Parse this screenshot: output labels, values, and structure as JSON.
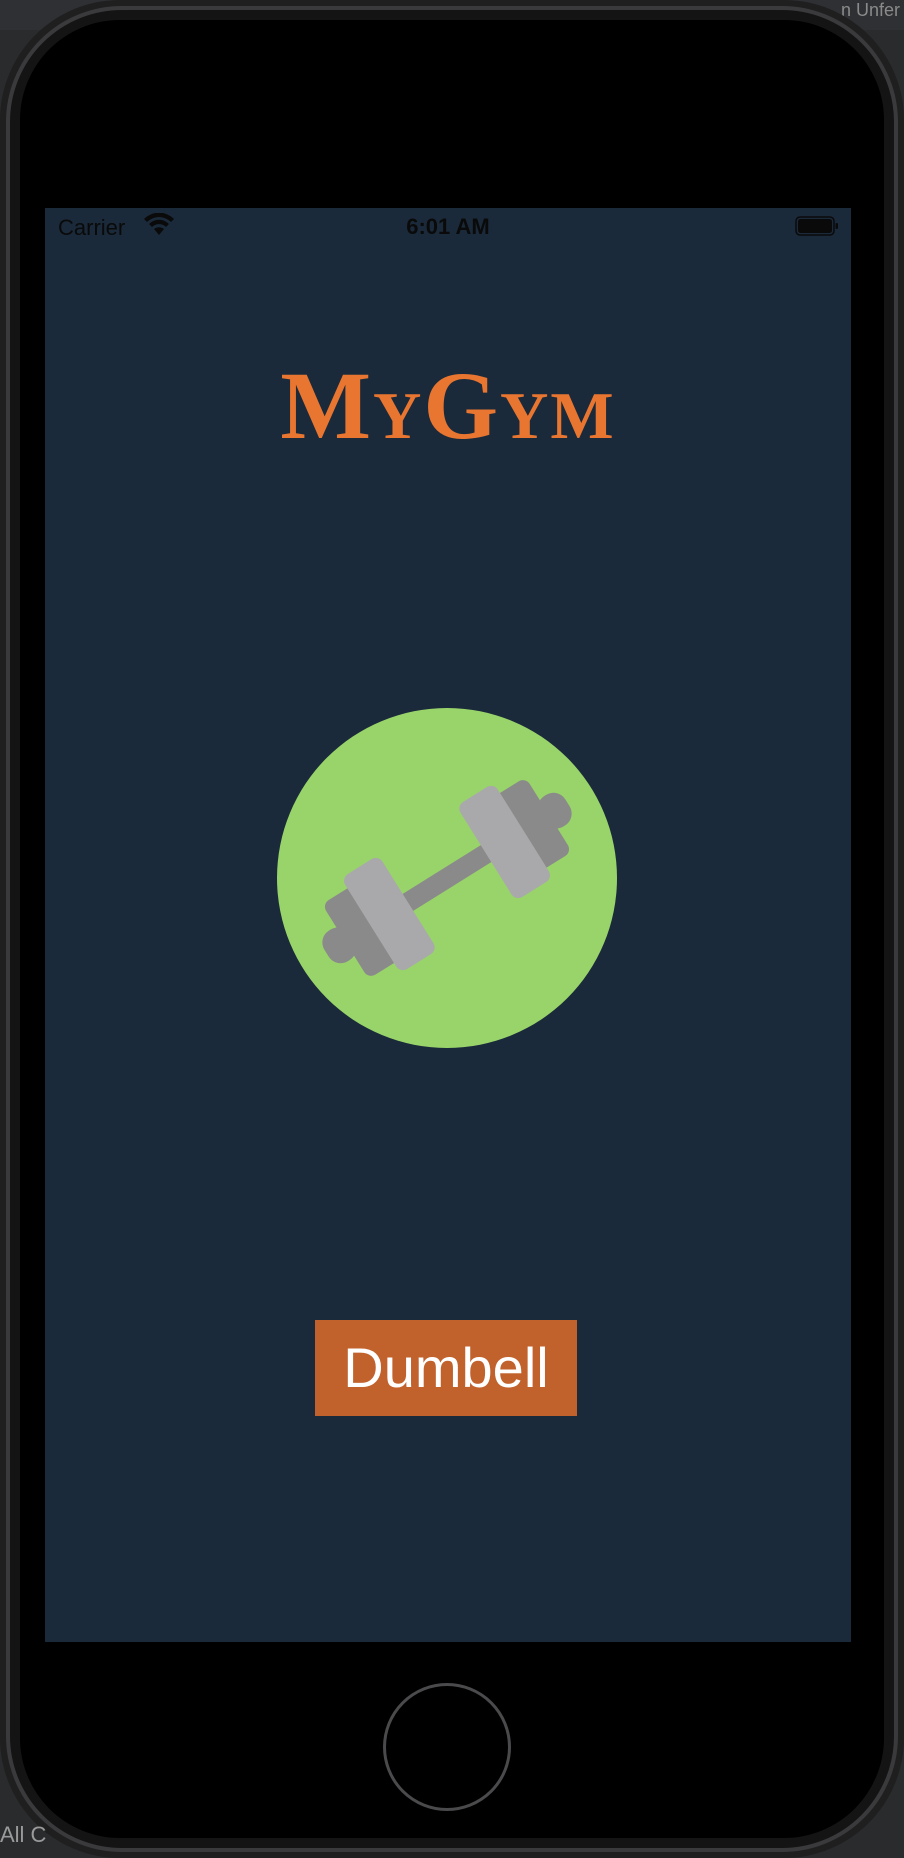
{
  "ide": {
    "corner_text": "n Unfer",
    "bottom_text": "All C"
  },
  "status_bar": {
    "carrier": "Carrier",
    "time": "6:01 AM"
  },
  "app": {
    "title": "MyGym",
    "logo_icon": "dumbbell-icon",
    "button_label": "Dumbell"
  },
  "colors": {
    "screen_bg": "#1a2a3a",
    "title": "#e87530",
    "button_bg": "#c1612c",
    "logo_circle": "#99d46a",
    "dumbbell_dark": "#8a8a8a",
    "dumbbell_light": "#a9a9ab"
  }
}
